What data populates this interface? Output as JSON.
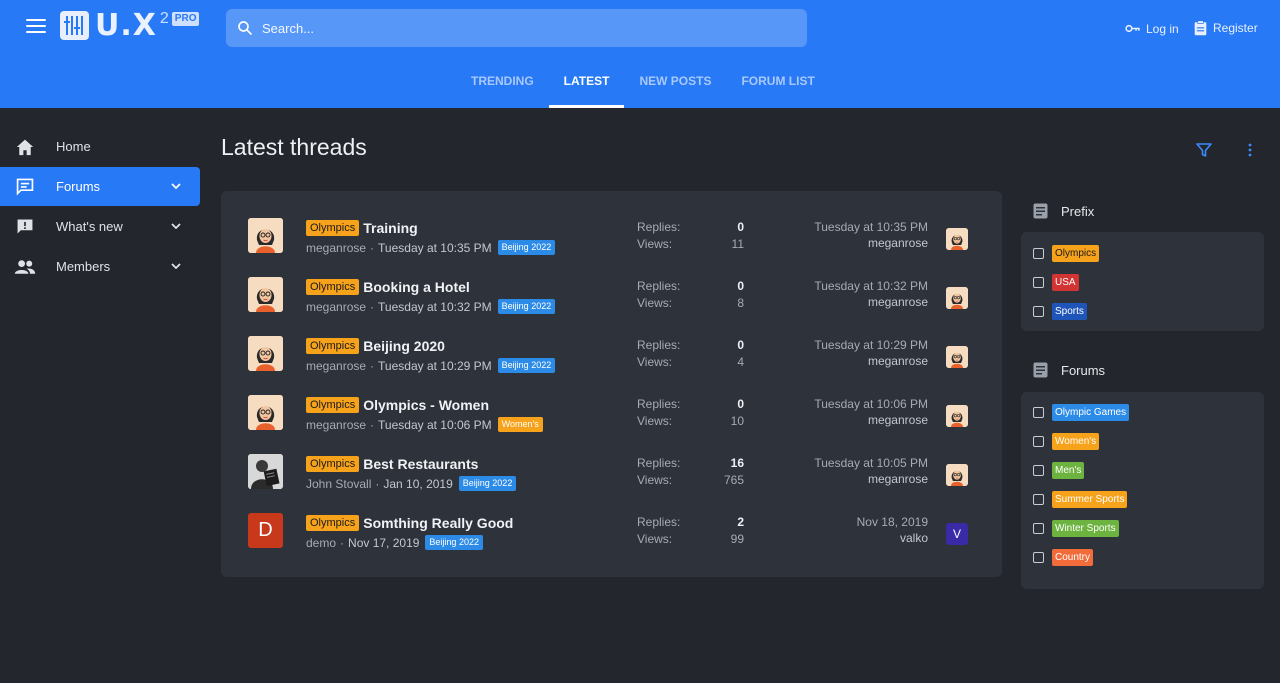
{
  "header": {
    "logo_text": "U.X",
    "logo_sup": "2",
    "logo_pro": "PRO",
    "search_placeholder": "Search...",
    "login_label": "Log in",
    "register_label": "Register",
    "tabs": [
      {
        "label": "TRENDING",
        "active": false
      },
      {
        "label": "LATEST",
        "active": true
      },
      {
        "label": "NEW POSTS",
        "active": false
      },
      {
        "label": "FORUM LIST",
        "active": false
      }
    ],
    "accent_color": "#2879f6"
  },
  "sidebar": {
    "items": [
      {
        "label": "Home",
        "icon": "home-icon",
        "active": false,
        "expandable": false
      },
      {
        "label": "Forums",
        "icon": "forums-icon",
        "active": true,
        "expandable": true
      },
      {
        "label": "What's new",
        "icon": "whats-new-icon",
        "active": false,
        "expandable": true
      },
      {
        "label": "Members",
        "icon": "members-icon",
        "active": false,
        "expandable": true
      }
    ]
  },
  "main": {
    "title": "Latest threads",
    "replies_label": "Replies:",
    "views_label": "Views:",
    "threads": [
      {
        "prefix": "Olympics",
        "title": "Training",
        "author": "meganrose",
        "date": "Tuesday at 10:35 PM",
        "tag": "Beijing 2022",
        "tag_color": "#2d8be8",
        "replies": "0",
        "views": "11",
        "last_date": "Tuesday at 10:35 PM",
        "last_user": "meganrose",
        "avatar": "illustration",
        "last_avatar": "illustration"
      },
      {
        "prefix": "Olympics",
        "title": "Booking a Hotel",
        "author": "meganrose",
        "date": "Tuesday at 10:32 PM",
        "tag": "Beijing 2022",
        "tag_color": "#2d8be8",
        "replies": "0",
        "views": "8",
        "last_date": "Tuesday at 10:32 PM",
        "last_user": "meganrose",
        "avatar": "illustration",
        "last_avatar": "illustration"
      },
      {
        "prefix": "Olympics",
        "title": "Beijing 2020",
        "author": "meganrose",
        "date": "Tuesday at 10:29 PM",
        "tag": "Beijing 2022",
        "tag_color": "#2d8be8",
        "replies": "0",
        "views": "4",
        "last_date": "Tuesday at 10:29 PM",
        "last_user": "meganrose",
        "avatar": "illustration",
        "last_avatar": "illustration"
      },
      {
        "prefix": "Olympics",
        "title": "Olympics - Women",
        "author": "meganrose",
        "date": "Tuesday at 10:06 PM",
        "tag": "Women's",
        "tag_color": "#f7a21b",
        "replies": "0",
        "views": "10",
        "last_date": "Tuesday at 10:06 PM",
        "last_user": "meganrose",
        "avatar": "illustration",
        "last_avatar": "illustration"
      },
      {
        "prefix": "Olympics",
        "title": "Best Restaurants",
        "author": "John Stovall",
        "date": "Jan 10, 2019",
        "tag": "Beijing 2022",
        "tag_color": "#2d8be8",
        "replies": "16",
        "views": "765",
        "last_date": "Tuesday at 10:05 PM",
        "last_user": "meganrose",
        "avatar": "photo",
        "last_avatar": "illustration"
      },
      {
        "prefix": "Olympics",
        "title": "Somthing Really Good",
        "author": "demo",
        "date": "Nov 17, 2019",
        "tag": "Beijing 2022",
        "tag_color": "#2d8be8",
        "replies": "2",
        "views": "99",
        "last_date": "Nov 18, 2019",
        "last_user": "valko",
        "avatar_letter": "D",
        "avatar_color": "#c8381a",
        "last_avatar_letter": "V",
        "last_avatar_color": "#3a2aa8"
      }
    ]
  },
  "filters": {
    "prefix_title": "Prefix",
    "prefix_items": [
      {
        "label": "Olympics",
        "bg": "#f7a21b",
        "fg": "#1a1a1a"
      },
      {
        "label": "USA",
        "bg": "#d23434",
        "fg": "#ffffff"
      },
      {
        "label": "Sports",
        "bg": "#1f55b8",
        "fg": "#ffffff"
      }
    ],
    "forums_title": "Forums",
    "forum_items": [
      {
        "label": "Olympic Games",
        "bg": "#2d8be8",
        "fg": "#ffffff"
      },
      {
        "label": "Women's",
        "bg": "#f7a21b",
        "fg": "#ffffff"
      },
      {
        "label": "Men's",
        "bg": "#6cb33f",
        "fg": "#ffffff"
      },
      {
        "label": "Summer Sports",
        "bg": "#f7a21b",
        "fg": "#ffffff"
      },
      {
        "label": "Winter Sports",
        "bg": "#6cb33f",
        "fg": "#ffffff"
      },
      {
        "label": "Country",
        "bg": "#f26b3a",
        "fg": "#ffffff"
      }
    ]
  }
}
